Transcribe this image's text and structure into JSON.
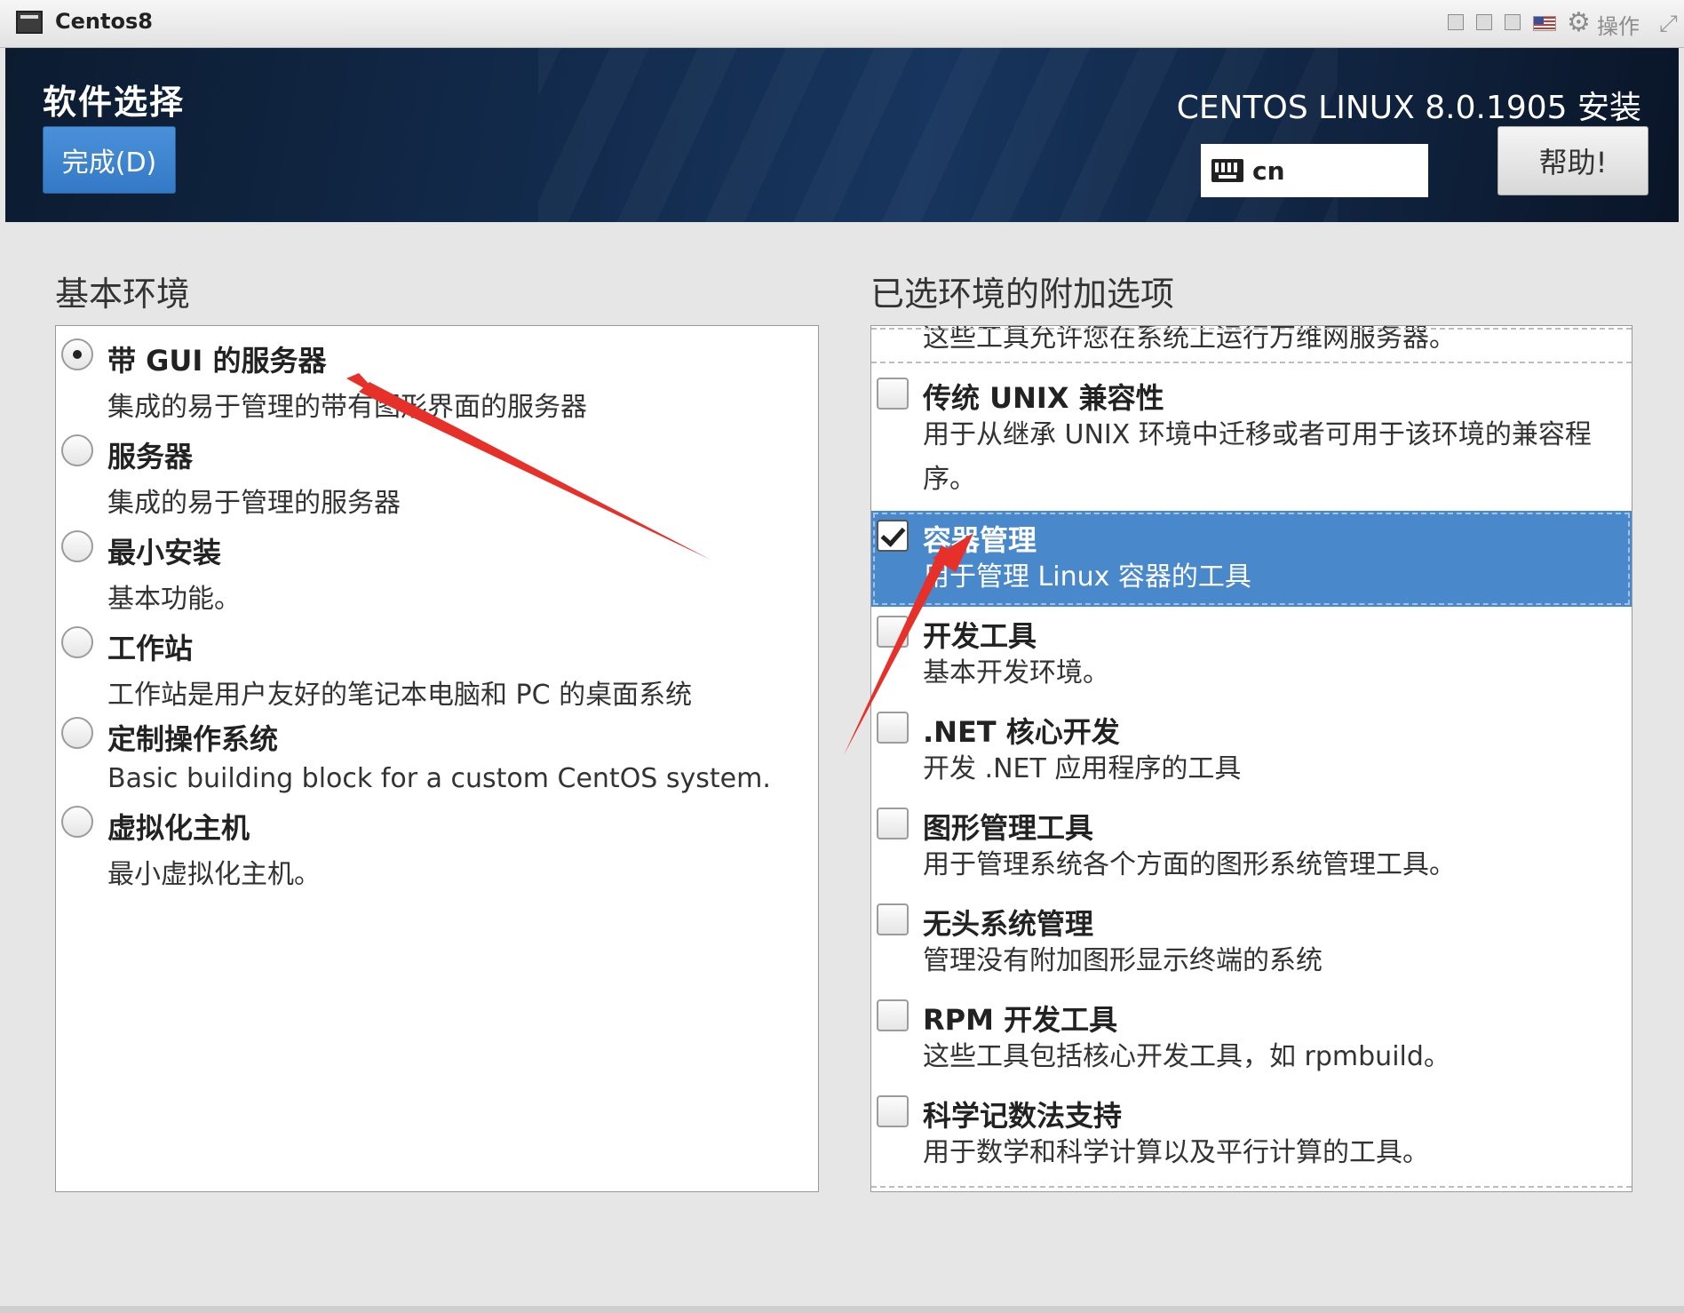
{
  "window": {
    "title": "Centos8",
    "ops_label": "操作",
    "icons": [
      "window-icon",
      "minimize-icon",
      "restore-icon",
      "fullscreen-icon",
      "flag-icon",
      "gear-icon",
      "resize-icon"
    ]
  },
  "header": {
    "page_title": "软件选择",
    "done_button": "完成(D)",
    "product_title": "CENTOS LINUX 8.0.1905 安装",
    "keyboard_layout": "cn",
    "help_button": "帮助!"
  },
  "base_environment": {
    "title": "基本环境",
    "items": [
      {
        "name": "带 GUI 的服务器",
        "desc": "集成的易于管理的带有图形界面的服务器",
        "selected": true
      },
      {
        "name": "服务器",
        "desc": "集成的易于管理的服务器",
        "selected": false
      },
      {
        "name": "最小安装",
        "desc": "基本功能。",
        "selected": false
      },
      {
        "name": "工作站",
        "desc": "工作站是用户友好的笔记本电脑和 PC 的桌面系统",
        "selected": false
      },
      {
        "name": "定制操作系统",
        "desc": "Basic building block for a custom CentOS system.",
        "selected": false
      },
      {
        "name": "虚拟化主机",
        "desc": "最小虚拟化主机。",
        "selected": false
      }
    ]
  },
  "addons": {
    "title": "已选环境的附加选项",
    "partial_top_text": "这些工具允许您在系统上运行万维网服务器。",
    "items": [
      {
        "name": "传统 UNIX 兼容性",
        "desc": "用于从继承 UNIX 环境中迁移或者可用于该环境的兼容程序。",
        "checked": false
      },
      {
        "name": "容器管理",
        "desc": "用于管理 Linux 容器的工具",
        "checked": true
      },
      {
        "name": "开发工具",
        "desc": "基本开发环境。",
        "checked": false
      },
      {
        "name": ".NET 核心开发",
        "desc": "开发 .NET 应用程序的工具",
        "checked": false
      },
      {
        "name": "图形管理工具",
        "desc": "用于管理系统各个方面的图形系统管理工具。",
        "checked": false
      },
      {
        "name": "无头系统管理",
        "desc": "管理没有附加图形显示终端的系统",
        "checked": false
      },
      {
        "name": "RPM 开发工具",
        "desc": "这些工具包括核心开发工具，如 rpmbuild。",
        "checked": false
      },
      {
        "name": "科学记数法支持",
        "desc": "用于数学和科学计算以及平行计算的工具。",
        "checked": false
      }
    ]
  },
  "colors": {
    "selection": "#4a88cc",
    "done_button": "#3a82d0",
    "annotation_arrow": "#e8302a"
  }
}
